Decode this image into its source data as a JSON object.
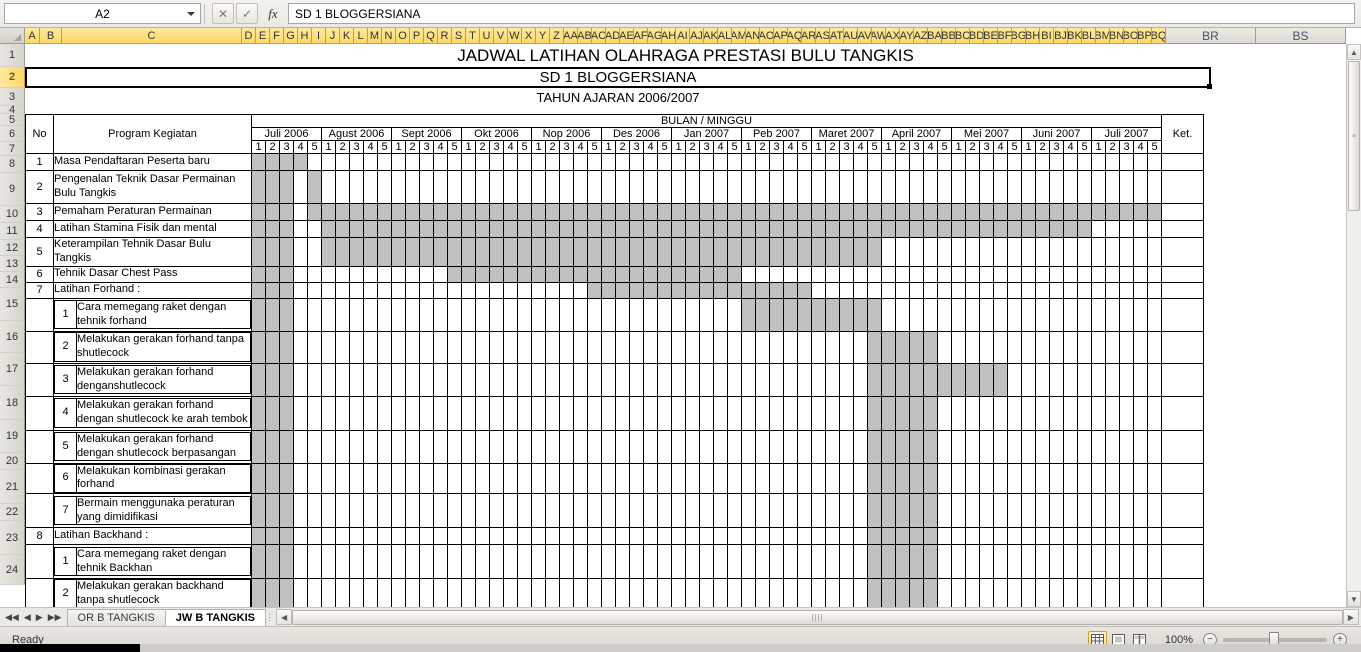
{
  "formula_bar": {
    "name_box_value": "A2",
    "formula_value": "SD 1 BLOGGERSIANA",
    "cancel_icon": "cancel-icon",
    "enter_icon": "enter-icon",
    "fx_label": "fx"
  },
  "columns": {
    "narrow": [
      "A",
      "B",
      "C",
      "D",
      "E",
      "F",
      "G",
      "H",
      "I",
      "J",
      "K",
      "L",
      "M",
      "N",
      "O",
      "P",
      "Q",
      "R",
      "S",
      "T",
      "U",
      "V",
      "W",
      "X",
      "Y",
      "Z",
      "AA",
      "AB",
      "AC",
      "AD",
      "AE",
      "AF",
      "AG",
      "AH",
      "AI",
      "AJ",
      "AK",
      "AL",
      "AM",
      "AN",
      "AO",
      "AP",
      "AQ",
      "AR",
      "AS",
      "AT",
      "AU",
      "AV",
      "AW",
      "AX",
      "AY",
      "AZ",
      "BA",
      "BB",
      "BC",
      "BD",
      "BE",
      "BF",
      "BG",
      "BH",
      "BI",
      "BJ",
      "BK",
      "BL",
      "BM",
      "BN",
      "BO",
      "BP",
      "BQ"
    ],
    "inactive": [
      "BR",
      "BS"
    ]
  },
  "rows": [
    "1",
    "2",
    "3",
    "4",
    "5",
    "6",
    "7",
    "8",
    "9",
    "10",
    "11",
    "12",
    "13",
    "14",
    "15",
    "16",
    "17",
    "18",
    "19",
    "20",
    "21",
    "22",
    "23",
    "24"
  ],
  "titles": {
    "line1": "JADWAL LATIHAN OLAHRAGA PRESTASI BULU TANGKIS",
    "line2": "SD 1 BLOGGERSIANA",
    "line3": "TAHUN AJARAN 2006/2007"
  },
  "table_header": {
    "no": "No",
    "program": "Program Kegiatan",
    "bulan_minggu": "BULAN / MINGGU",
    "ket": "Ket.",
    "months": [
      "Juli 2006",
      "Agust 2006",
      "Sept 2006",
      "Okt 2006",
      "Nop 2006",
      "Des 2006",
      "Jan 2007",
      "Peb 2007",
      "Maret  2007",
      "April 2007",
      "Mei 2007",
      "Juni 2007",
      "Juli 2007"
    ],
    "weeks": [
      "1",
      "2",
      "3",
      "4",
      "5"
    ]
  },
  "chart_data": {
    "type": "table",
    "title": "JADWAL LATIHAN OLAHRAGA PRESTASI BULU TANGKIS",
    "xlabel": "BULAN / MINGGU",
    "categories": [
      "Juli 2006",
      "Agust 2006",
      "Sept 2006",
      "Okt 2006",
      "Nop 2006",
      "Des 2006",
      "Jan 2007",
      "Peb 2007",
      "Maret  2007",
      "April 2007",
      "Mei 2007",
      "Juni 2007",
      "Juli 2007"
    ],
    "weeks_per_month": 5,
    "total_week_slots": 65,
    "tasks": [
      {
        "row": "8",
        "no": "1",
        "label": "Masa Pendaftaran Peserta baru",
        "sub_no": "",
        "sub": false,
        "bars": [
          [
            0,
            3
          ]
        ]
      },
      {
        "row": "9",
        "no": "2",
        "label": "Pengenalan Teknik Dasar Permainan Bulu Tangkis",
        "sub_no": "",
        "sub": false,
        "bars": [
          [
            0,
            2
          ],
          [
            4,
            4
          ]
        ]
      },
      {
        "row": "10",
        "no": "3",
        "label": "Pemaham Peraturan Permainan",
        "sub_no": "",
        "sub": false,
        "bars": [
          [
            0,
            2
          ],
          [
            4,
            64
          ]
        ]
      },
      {
        "row": "11",
        "no": "4",
        "label": "Latihan Stamina  Fisik dan mental",
        "sub_no": "",
        "sub": false,
        "bars": [
          [
            0,
            2
          ],
          [
            5,
            59
          ]
        ]
      },
      {
        "row": "12",
        "no": "5",
        "label": "Keterampilan Tehnik Dasar Bulu Tangkis",
        "sub_no": "",
        "sub": false,
        "bars": [
          [
            0,
            2
          ],
          [
            5,
            44
          ]
        ]
      },
      {
        "row": "13",
        "no": "6",
        "label": "Tehnik Dasar Chest Pass",
        "sub_no": "",
        "sub": false,
        "bars": [
          [
            0,
            2
          ],
          [
            14,
            34
          ]
        ]
      },
      {
        "row": "14",
        "no": "7",
        "label": "Latihan Forhand :",
        "sub_no": "",
        "sub": false,
        "bars": [
          [
            0,
            2
          ],
          [
            24,
            39
          ]
        ]
      },
      {
        "row": "15",
        "no": "",
        "label": "Cara memegang raket dengan tehnik forhand",
        "sub_no": "1",
        "sub": true,
        "bars": [
          [
            0,
            2
          ],
          [
            35,
            44
          ]
        ]
      },
      {
        "row": "16",
        "no": "",
        "label": "Melakukan gerakan forhand tanpa shutlecock",
        "sub_no": "2",
        "sub": true,
        "bars": [
          [
            0,
            2
          ],
          [
            44,
            48
          ]
        ]
      },
      {
        "row": "17",
        "no": "",
        "label": "Melakukan gerakan forhand denganshutlecock",
        "sub_no": "3",
        "sub": true,
        "bars": [
          [
            0,
            2
          ],
          [
            44,
            53
          ]
        ]
      },
      {
        "row": "18",
        "no": "",
        "label": "Melakukan gerakan forhand dengan shutlecock ke arah tembok",
        "sub_no": "4",
        "sub": true,
        "bars": [
          [
            0,
            2
          ],
          [
            44,
            48
          ]
        ]
      },
      {
        "row": "19",
        "no": "",
        "label": "Melakukan gerakan forhand dengan shutlecock berpasangan",
        "sub_no": "5",
        "sub": true,
        "bars": [
          [
            0,
            2
          ],
          [
            44,
            48
          ]
        ]
      },
      {
        "row": "20",
        "no": "",
        "label": "Melakukan kombinasi gerakan forhand",
        "sub_no": "6",
        "sub": true,
        "bars": [
          [
            0,
            2
          ],
          [
            44,
            48
          ]
        ]
      },
      {
        "row": "21",
        "no": "",
        "label": "Bermain menggunaka peraturan yang dimidifikasi",
        "sub_no": "7",
        "sub": true,
        "bars": [
          [
            0,
            2
          ],
          [
            44,
            48
          ]
        ]
      },
      {
        "row": "22",
        "no": "8",
        "label": "Latihan Backhand :",
        "sub_no": "",
        "sub": false,
        "bars": [
          [
            0,
            2
          ],
          [
            44,
            48
          ]
        ]
      },
      {
        "row": "23",
        "no": "",
        "label": "Cara memegang raket dengan tehnik Backhan",
        "sub_no": "1",
        "sub": true,
        "bars": [
          [
            0,
            2
          ],
          [
            44,
            48
          ]
        ]
      },
      {
        "row": "24",
        "no": "",
        "label": "Melakukan gerakan backhand tanpa shutlecock",
        "sub_no": "2",
        "sub": true,
        "bars": [
          [
            0,
            2
          ],
          [
            44,
            48
          ]
        ]
      }
    ]
  },
  "sheet_tabs": [
    {
      "label": "OR B TANGKIS",
      "active": false
    },
    {
      "label": "JW B TANGKIS",
      "active": true
    }
  ],
  "nav": {
    "first": "◀◀",
    "prev": "◀",
    "next": "▶",
    "last": "▶▶"
  },
  "status": {
    "text": "Ready",
    "zoom": "100%",
    "view_normal": "normal-view-icon",
    "view_layout": "page-layout-icon",
    "view_break": "page-break-icon",
    "zoom_out": "−",
    "zoom_in": "+"
  },
  "colors": {
    "header_yellow": "#fbd968",
    "bar_gray": "#c0c0c0",
    "grid_black": "#000000"
  }
}
